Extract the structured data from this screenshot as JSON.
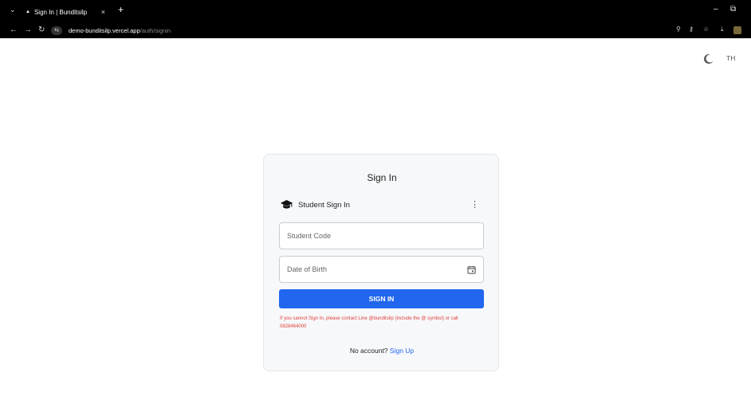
{
  "browser": {
    "tab_title": "Sign In | Bunditsilp",
    "tab_close": "×",
    "new_tab": "+",
    "url_host": "demo-bunditsilp.vercel.app",
    "url_path": "/auth/signin"
  },
  "header": {
    "language": "TH"
  },
  "signin": {
    "title": "Sign In",
    "method_label": "Student Sign In",
    "student_code_placeholder": "Student Code",
    "dob_placeholder": "Date of Birth",
    "submit_label": "SIGN IN",
    "error_text": "If you cannot Sign In, please contact Line @bunditsilp (include the @ symbol) or call 0828464000",
    "no_account_text": "No account?",
    "signup_label": "Sign Up"
  },
  "colors": {
    "accent": "#2166ee",
    "error": "#e0403a"
  }
}
